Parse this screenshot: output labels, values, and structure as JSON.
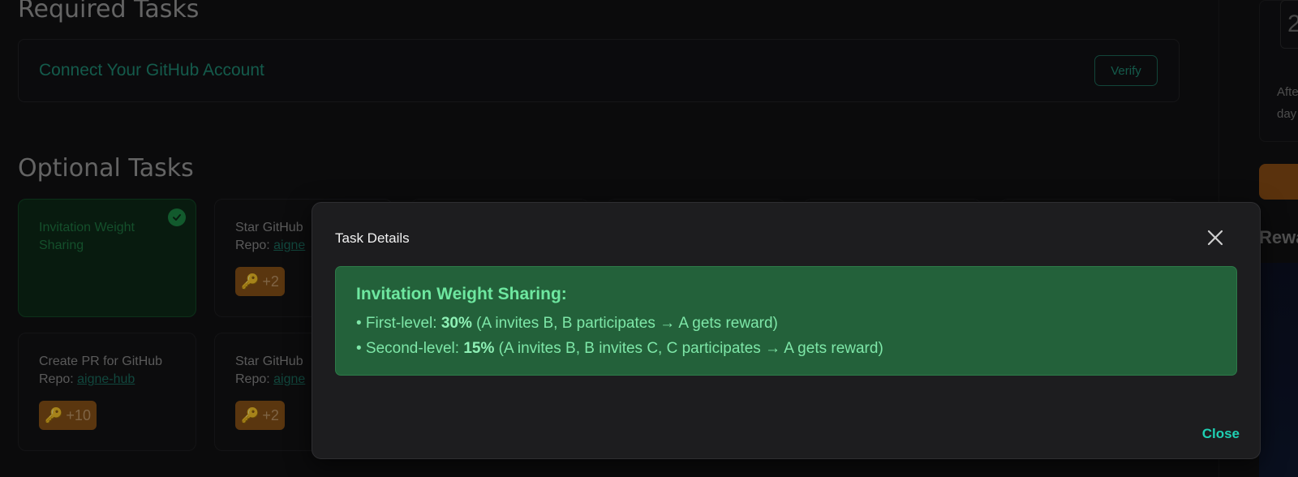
{
  "required": {
    "title": "Required Tasks",
    "task_label": "Connect Your GitHub Account",
    "verify_label": "Verify"
  },
  "optional": {
    "title": "Optional Tasks",
    "cards": [
      {
        "title": "Invitation Weight Sharing",
        "repo_prefix": "",
        "repo_link": "",
        "reward": "",
        "done": true
      },
      {
        "title": "Star GitHub",
        "repo_prefix": "Repo: ",
        "repo_link": "aigne",
        "reward": "+2",
        "done": false
      },
      {
        "title": "Create PR for GitHub",
        "repo_prefix": "Repo: ",
        "repo_link": "aigne-hub",
        "reward": "+10",
        "done": false
      },
      {
        "title": "Star GitHub",
        "repo_prefix": "Repo: ",
        "repo_link": "aigne",
        "reward": "+2",
        "done": false
      }
    ]
  },
  "right_panel": {
    "number": "2",
    "text1": "Afte",
    "text2": "day",
    "rewards_heading": "Rewa"
  },
  "modal": {
    "title": "Task Details",
    "heading": "Invitation Weight Sharing:",
    "line1_prefix": "• First-level: ",
    "line1_pct": "30%",
    "line1_suffix": " (A invites B, B participates → A gets reward)",
    "line2_prefix": "• Second-level: ",
    "line2_pct": "15%",
    "line2_suffix": " (A invites B, B invites C, C participates → A gets reward)",
    "close_label": "Close"
  },
  "colors": {
    "accent_teal": "#1fd0b3",
    "detail_bg": "#23613a",
    "reward_orange": "#8b5318",
    "success_green": "#1d8a45"
  },
  "icons": [
    "check-icon",
    "key-icon",
    "close-icon"
  ]
}
